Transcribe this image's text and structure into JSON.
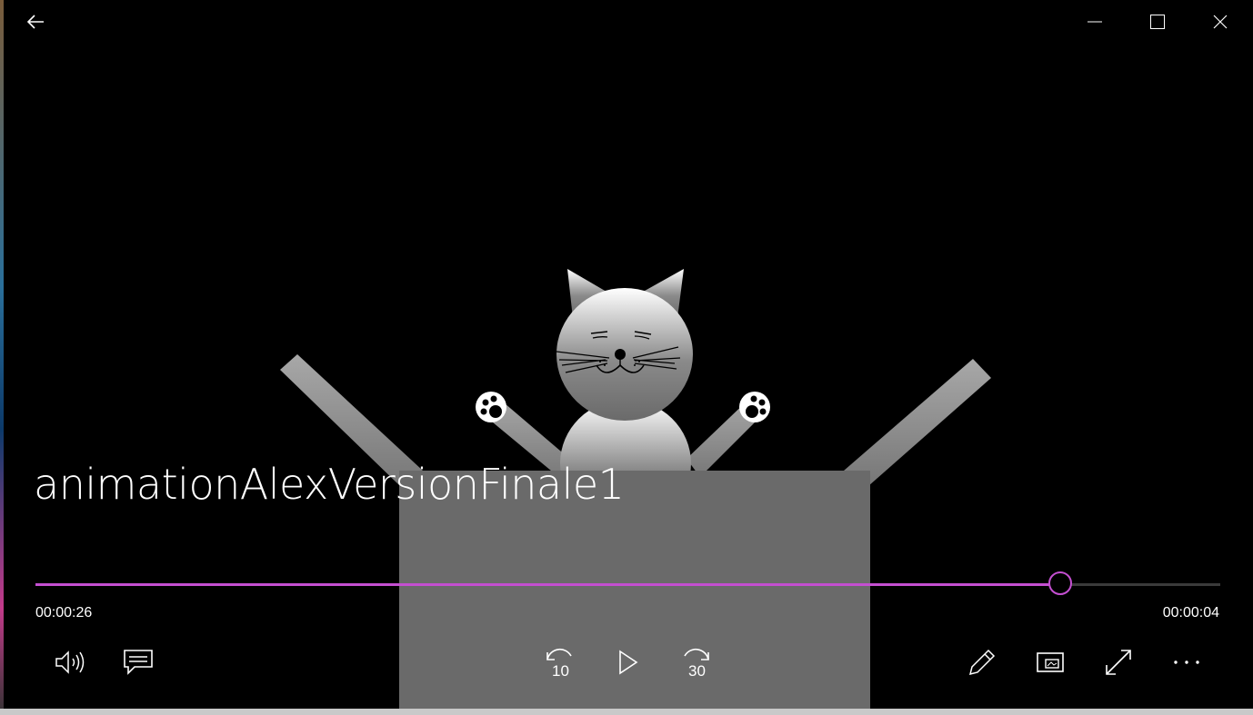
{
  "app": {
    "window_controls": [
      "back-icon",
      "minimize-icon",
      "maximize-icon",
      "close-icon"
    ]
  },
  "media": {
    "title": "animationAlexVersionFinale1",
    "elapsed": "00:00:26",
    "remaining": "00:00:04",
    "progress_fraction": 0.865
  },
  "controls": {
    "skip_back_label": "10",
    "skip_forward_label": "30",
    "left": [
      "volume-icon",
      "captions-icon"
    ],
    "center": [
      "skip-back-10-icon",
      "play-icon",
      "skip-forward-30-icon"
    ],
    "right": [
      "edit-pencil-icon",
      "mini-view-icon",
      "fullscreen-icon",
      "more-options-icon"
    ]
  },
  "colors": {
    "accent": "#c44fd1",
    "background": "#000000"
  }
}
